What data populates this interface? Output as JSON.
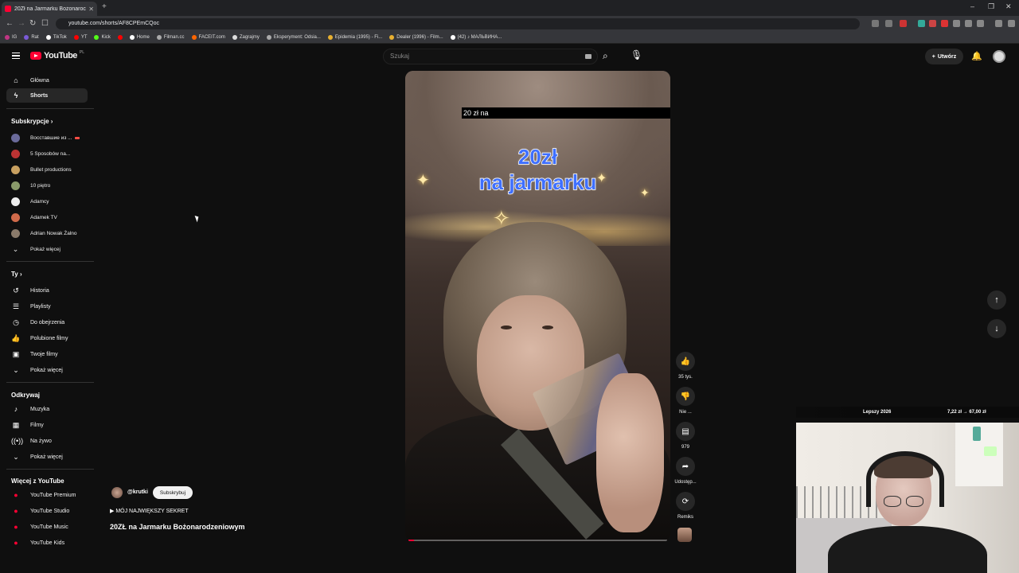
{
  "browser": {
    "tab_title": "20Zł na Jarmarku Bożonaroc",
    "url": "youtube.com/shorts/AF8CPEmCQoc",
    "bookmarks": [
      "IG",
      "Rat",
      "TikTok",
      "YT",
      "Kick",
      "",
      "Home",
      "Filman.cc",
      "FACEIT.com",
      "Zagrajmy",
      "Eksperyment: Odsia...",
      "Epidemia (1995) - Fi...",
      "Dealer (1996) - Film...",
      "(42) ♪ МАЛЬВИНА..."
    ]
  },
  "masthead": {
    "logo_text": "YouTube",
    "country_code": "PL",
    "search_placeholder": "Szukaj",
    "create_label": "Utwórz"
  },
  "sidebar": {
    "main": [
      {
        "label": "Główna",
        "icon": "home-icon"
      },
      {
        "label": "Shorts",
        "icon": "shorts-icon"
      }
    ],
    "subscriptions_header": "Subskrypcje",
    "subscriptions": [
      {
        "label": "Восставшие из ...",
        "color": "#6a6a9a"
      },
      {
        "label": "5 Sposobów na...",
        "color": "#b33"
      },
      {
        "label": "Bullet productions",
        "color": "#c8a060"
      },
      {
        "label": "10 piętro",
        "color": "#8a9a6a"
      },
      {
        "label": "Adamcy",
        "color": "#eeeeee"
      },
      {
        "label": "Adamek TV",
        "color": "#d06a4a"
      },
      {
        "label": "Adrian Nowak Żalno",
        "color": "#8a7a6a"
      }
    ],
    "subs_more": "Pokaż więcej",
    "you_header": "Ty",
    "you": [
      {
        "label": "Historia",
        "icon": "history-icon"
      },
      {
        "label": "Playlisty",
        "icon": "playlist-icon"
      },
      {
        "label": "Do obejrzenia",
        "icon": "watch-later-icon"
      },
      {
        "label": "Polubione filmy",
        "icon": "like-icon"
      },
      {
        "label": "Twoje filmy",
        "icon": "your-videos-icon"
      },
      {
        "label": "Pokaż więcej",
        "icon": "chevron-down-icon"
      }
    ],
    "explore_header": "Odkrywaj",
    "explore": [
      {
        "label": "Muzyka",
        "icon": "music-icon"
      },
      {
        "label": "Filmy",
        "icon": "film-icon"
      },
      {
        "label": "Na żywo",
        "icon": "live-icon"
      },
      {
        "label": "Pokaż więcej",
        "icon": "chevron-down-icon"
      }
    ],
    "more_header": "Więcej z YouTube",
    "more": [
      {
        "label": "YouTube Premium"
      },
      {
        "label": "YouTube Studio"
      },
      {
        "label": "YouTube Music"
      },
      {
        "label": "YouTube Kids"
      }
    ]
  },
  "short": {
    "caption": "20 zł na",
    "title_line1": "20zł",
    "title_line2": "na jarmarku",
    "progress": 0.02,
    "channel": "@krutki",
    "subscribe_label": "Subskrybuj",
    "music": "▶ MÓJ NAJWIĘKSZY SEKRET",
    "video_title": "20ZŁ na Jarmarku Bożonarodzeniowym"
  },
  "actions": {
    "like_count": "35 tys.",
    "dislike_label": "Nie ...",
    "comments_count": "979",
    "share_label": "Udostęp...",
    "remix_label": "Remiks"
  },
  "overlay": {
    "left": "Lepszy 2026",
    "right": "7,22 zł → 67,00 zł"
  }
}
